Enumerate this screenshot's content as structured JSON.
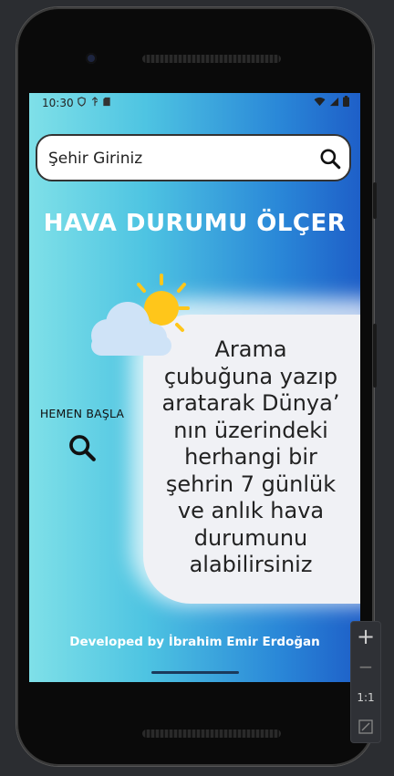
{
  "status_bar": {
    "time": "10:30",
    "left_icons": [
      "shield-icon",
      "usb-icon",
      "sd-card-icon"
    ],
    "right_icons": [
      "wifi-icon",
      "signal-icon",
      "battery-icon"
    ]
  },
  "search": {
    "placeholder": "Şehir Giriniz",
    "icon": "search-icon"
  },
  "app_title": "HAVA DURUMU ÖLÇER",
  "weather_illustration": "partly-cloudy-icon",
  "start": {
    "label": "HEMEN BAŞLA",
    "icon": "search-icon"
  },
  "info_text": "Arama çubuğuna yazıp aratarak Dünya’nın üzerindeki herhangi bir şehrin 7 günlük ve anlık hava durumunu alabilirsiniz",
  "info_lines": [
    "Arama",
    "çubuğuna yazıp",
    "aratarak Dünya’",
    "nın üzerindeki",
    "herhangi bir",
    "şehrin 7 günlük",
    "ve anlık hava",
    "durumunu",
    "alabilirsiniz"
  ],
  "footer": "Developed by İbrahim Emir Erdoğan",
  "emulator_zoom": {
    "zoom_in": "+",
    "zoom_out": "−",
    "ratio": "1:1",
    "fit_icon": "fit-screen-icon"
  },
  "colors": {
    "gradient_start": "#7fe0e8",
    "gradient_end": "#1e5fc8",
    "card": "#f0f1f5",
    "sun": "#ffc61a",
    "cloud": "#cfe3f7"
  }
}
